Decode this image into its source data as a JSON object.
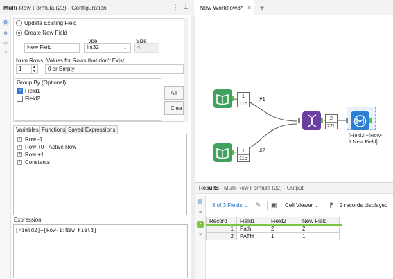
{
  "config": {
    "title_bold": "Multi",
    "title_rest": "-Row Formula (22) - Configuration",
    "update_existing_label": "Update Existing Field",
    "create_new_label": "Create New  Field",
    "type_label": "Type",
    "size_label": "Size",
    "new_field_value": "New Field",
    "type_value": "Int32",
    "size_value": "4",
    "num_rows_label": "Num Rows",
    "values_nonexist_label": "Values for Rows that don't Exist",
    "num_rows_value": "1",
    "nonexist_value": "0 or Empty",
    "group_by_label": "Group By (Optional)",
    "group_fields": [
      {
        "name": "Field1",
        "checked": true
      },
      {
        "name": "Field2",
        "checked": false
      }
    ],
    "all_button": "All",
    "clear_button": "Clea",
    "tabs": [
      "Variables",
      "Functions",
      "Saved Expressions"
    ],
    "tree_items": [
      "Row -1",
      "Row +0 - Active Row",
      "Row +1",
      "Constants"
    ],
    "expression_label": "Expression:",
    "expression_value": "[Field2]+[Row-1:New Field]"
  },
  "workflow": {
    "tab_label": "New Workflow3*",
    "add_tab": "+",
    "conn1_label": "#1",
    "conn2_label": "#2",
    "input1_badge": [
      "1",
      "11b"
    ],
    "input2_badge": [
      "1",
      "11b"
    ],
    "union_badge": [
      "2",
      "22b"
    ],
    "formula_caption": "[Field2]+[Row-1:New Field]",
    "colors": {
      "input_node": "#3fa35f",
      "union_node": "#6b3fa0",
      "formula_node": "#2d7fd3",
      "anchor": "#5fbf3b"
    }
  },
  "results": {
    "title": "Results",
    "subtitle": " - Multi-Row Formula (22) - Output",
    "fields_dropdown": "3 of 3 Fields",
    "cell_viewer": "Cell Viewer",
    "records_displayed": "2 records displayed",
    "columns": [
      "Record",
      "Field1",
      "Field2",
      "New Field"
    ],
    "rows": [
      [
        "1",
        "Path",
        "2",
        "2"
      ],
      [
        "2",
        "PATH",
        "1",
        "1"
      ]
    ]
  }
}
